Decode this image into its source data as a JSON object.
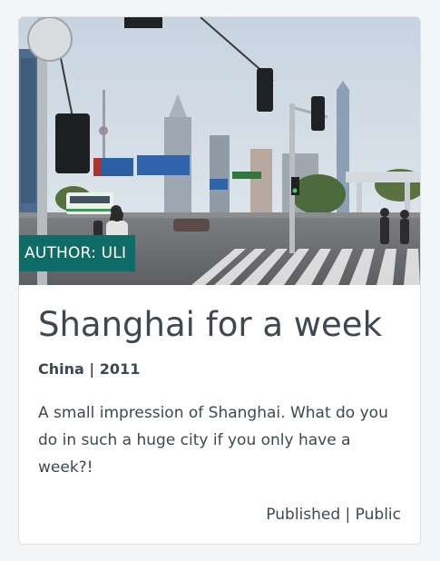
{
  "card": {
    "image": {
      "subject": "shanghai-street-scene"
    },
    "author_badge": "AUTHOR: ULI",
    "title": "Shanghai for a week",
    "meta": "China | 2011",
    "description": "A small impression of Shanghai. What do you do in such a huge city if you only have a week?!",
    "status": "Published | Public"
  },
  "colors": {
    "badge": "#0f6b66",
    "text": "#3e4752",
    "page_bg": "#f4f5f6"
  }
}
